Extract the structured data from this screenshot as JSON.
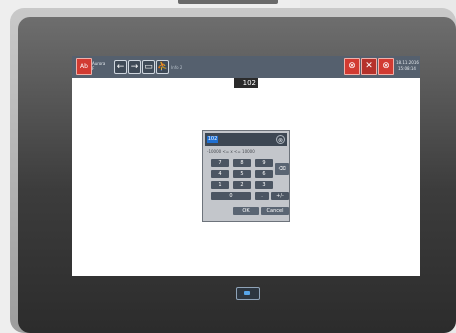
{
  "toolbar": {
    "logout_label": "Ab",
    "user_line1": "Aurora",
    "user_line2": "F",
    "back_icon": "←",
    "forward_icon": "→",
    "screen_icon": "▭",
    "user_icon": "⛹",
    "page_label": "Info 2",
    "alarm1_icon": "⊗",
    "alarm2_icon": "✕",
    "alarm3_icon": "⊗",
    "date_text": "18.11.2016",
    "time_text": "15:08:14"
  },
  "main": {
    "value_display": "102"
  },
  "keypad": {
    "input_value": "102",
    "close_icon": "⊗",
    "range_text": "-10000 <= x <= 10000",
    "keys": {
      "k7": "7",
      "k8": "8",
      "k9": "9",
      "backspace": "⌫",
      "k4": "4",
      "k5": "5",
      "k6": "6",
      "k1": "1",
      "k2": "2",
      "k3": "3",
      "k0": "0",
      "dot": ".",
      "plusminus": "+/-",
      "ok": "OK",
      "cancel": "Cancel"
    }
  },
  "colors": {
    "toolbar_bg": "#55606e",
    "alarm_red": "#d23b32",
    "key_bg": "#4b5562",
    "input_highlight": "#1f6fd1"
  }
}
